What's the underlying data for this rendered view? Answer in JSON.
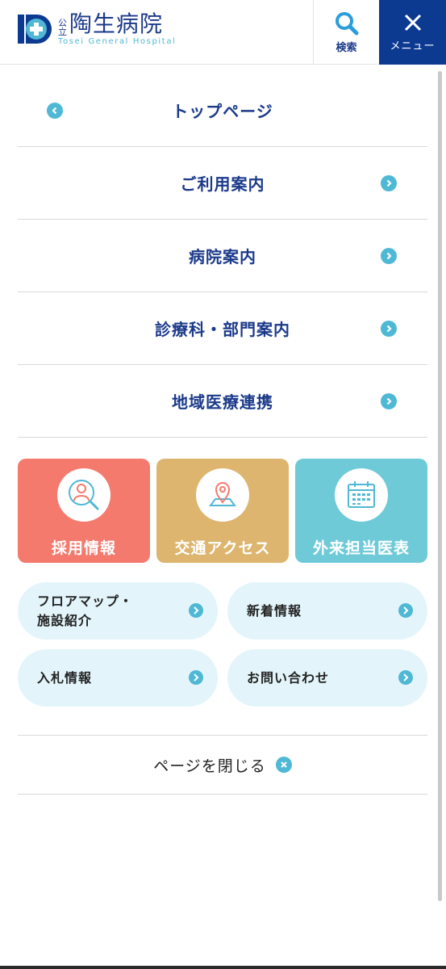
{
  "header": {
    "logo_prefix_top": "公",
    "logo_prefix_bottom": "立",
    "logo_name": "陶生病院",
    "logo_sub": "Tosei General Hospital",
    "search_label": "検索",
    "menu_label": "メニュー"
  },
  "nav": {
    "top": "トップページ",
    "items": [
      {
        "label": "ご利用案内"
      },
      {
        "label": "病院案内"
      },
      {
        "label": "診療科・部門案内"
      },
      {
        "label": "地域医療連携"
      }
    ]
  },
  "cards": [
    {
      "label": "採用情報",
      "icon": "person-search-icon",
      "color": "#f47a6e"
    },
    {
      "label": "交通アクセス",
      "icon": "map-pin-icon",
      "color": "#ddb56f"
    },
    {
      "label": "外来担当医表",
      "icon": "calendar-icon",
      "color": "#6fcad8"
    }
  ],
  "pills": [
    {
      "label_line1": "フロアマップ・",
      "label_line2": "施設紹介"
    },
    {
      "label": "新着情報"
    },
    {
      "label": "入札情報"
    },
    {
      "label": "お問い合わせ"
    }
  ],
  "close_label": "ページを閉じる",
  "colors": {
    "brand": "#0d3a91",
    "accent": "#4fb8d5",
    "pill_bg": "#e3f5fb"
  }
}
